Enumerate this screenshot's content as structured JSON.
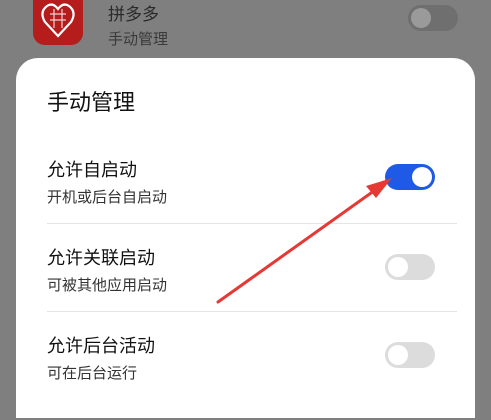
{
  "background_app": {
    "name": "拼多多",
    "subtitle": "手动管理",
    "toggle_on": false,
    "icon": "pinduoduo-app-icon"
  },
  "sheet": {
    "title": "手动管理",
    "items": [
      {
        "title": "允许自启动",
        "desc": "开机或后台自启动",
        "enabled": true
      },
      {
        "title": "允许关联启动",
        "desc": "可被其他应用启动",
        "enabled": false
      },
      {
        "title": "允许后台活动",
        "desc": "可在后台运行",
        "enabled": false
      }
    ]
  },
  "colors": {
    "toggle_on": "#1e5ae6",
    "annotation_arrow": "#e53935",
    "app_icon": "#b51c1c"
  }
}
